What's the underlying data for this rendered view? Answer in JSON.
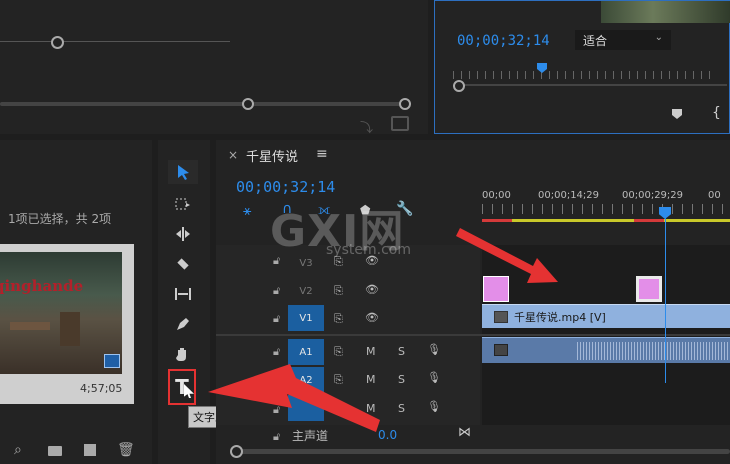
{
  "program_monitor": {
    "timecode": "00;00;32;14",
    "fit_label": "适合"
  },
  "project": {
    "selection_info": "1项已选择，共 2项",
    "thumb_title": "qinghande",
    "thumb_duration": "4;57;05"
  },
  "timeline": {
    "tab_title": "千星传说",
    "timecode": "00;00;32;14",
    "ruler": [
      "00;00",
      "00;00;14;29",
      "00;00;29;29",
      "00"
    ],
    "clip_label": "千星传说.mp4 [V]",
    "tracks_video": [
      "V3",
      "V2",
      "V1"
    ],
    "tracks_audio": [
      "A1",
      "A2",
      "A3"
    ],
    "master_label": "主声道",
    "master_value": "0.0"
  },
  "tooltip": "文字工具 (T)",
  "watermark": {
    "logo": "GXI网",
    "site": "system.com"
  },
  "colors": {
    "accent": "#2d8ceb",
    "clip": "#8fb1de",
    "pink": "#e38ee8",
    "arrow": "#e53232"
  }
}
